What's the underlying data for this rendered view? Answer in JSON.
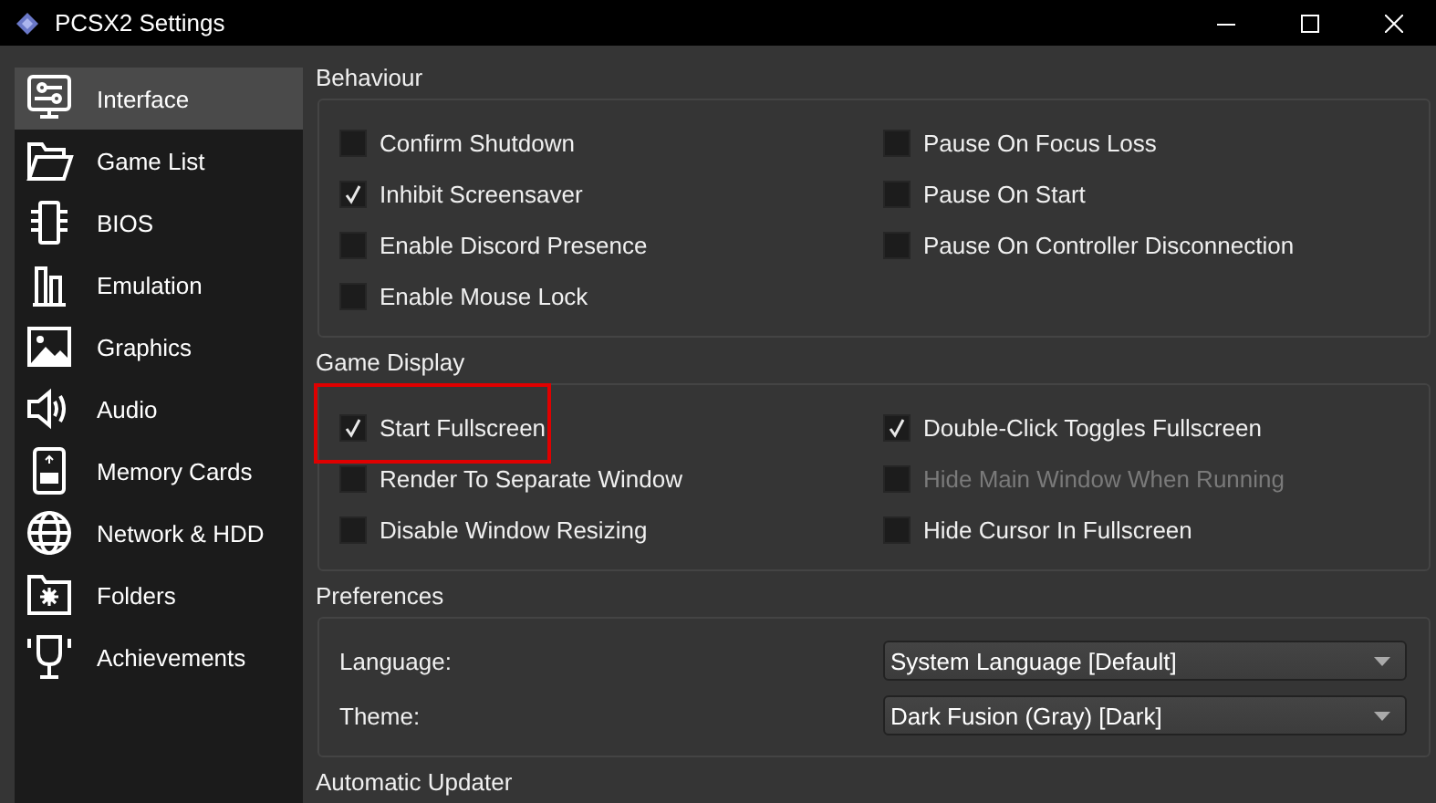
{
  "window": {
    "title": "PCSX2 Settings"
  },
  "sidebar": {
    "items": [
      {
        "label": "Interface",
        "selected": true
      },
      {
        "label": "Game List",
        "selected": false
      },
      {
        "label": "BIOS",
        "selected": false
      },
      {
        "label": "Emulation",
        "selected": false
      },
      {
        "label": "Graphics",
        "selected": false
      },
      {
        "label": "Audio",
        "selected": false
      },
      {
        "label": "Memory Cards",
        "selected": false
      },
      {
        "label": "Network & HDD",
        "selected": false
      },
      {
        "label": "Folders",
        "selected": false
      },
      {
        "label": "Achievements",
        "selected": false
      }
    ]
  },
  "groups": [
    {
      "title": "Behaviour",
      "kind": "checkboxes",
      "columns": [
        [
          {
            "label": "Confirm Shutdown",
            "checked": false,
            "disabled": false,
            "highlighted": false
          },
          {
            "label": "Inhibit Screensaver",
            "checked": true,
            "disabled": false,
            "highlighted": false
          },
          {
            "label": "Enable Discord Presence",
            "checked": false,
            "disabled": false,
            "highlighted": false
          },
          {
            "label": "Enable Mouse Lock",
            "checked": false,
            "disabled": false,
            "highlighted": false
          }
        ],
        [
          {
            "label": "Pause On Focus Loss",
            "checked": false,
            "disabled": false,
            "highlighted": false
          },
          {
            "label": "Pause On Start",
            "checked": false,
            "disabled": false,
            "highlighted": false
          },
          {
            "label": "Pause On Controller Disconnection",
            "checked": false,
            "disabled": false,
            "highlighted": false
          }
        ]
      ]
    },
    {
      "title": "Game Display",
      "kind": "checkboxes",
      "columns": [
        [
          {
            "label": "Start Fullscreen",
            "checked": true,
            "disabled": false,
            "highlighted": true
          },
          {
            "label": "Render To Separate Window",
            "checked": false,
            "disabled": false,
            "highlighted": false
          },
          {
            "label": "Disable Window Resizing",
            "checked": false,
            "disabled": false,
            "highlighted": false
          }
        ],
        [
          {
            "label": "Double-Click Toggles Fullscreen",
            "checked": true,
            "disabled": false,
            "highlighted": false
          },
          {
            "label": "Hide Main Window When Running",
            "checked": false,
            "disabled": true,
            "highlighted": false
          },
          {
            "label": "Hide Cursor In Fullscreen",
            "checked": false,
            "disabled": false,
            "highlighted": false
          }
        ]
      ]
    },
    {
      "title": "Preferences",
      "kind": "combos",
      "fields": [
        {
          "label": "Language:",
          "value": "System Language [Default]"
        },
        {
          "label": "Theme:",
          "value": "Dark Fusion (Gray) [Dark]"
        }
      ]
    },
    {
      "title": "Automatic Updater",
      "kind": "collapsed"
    }
  ]
}
